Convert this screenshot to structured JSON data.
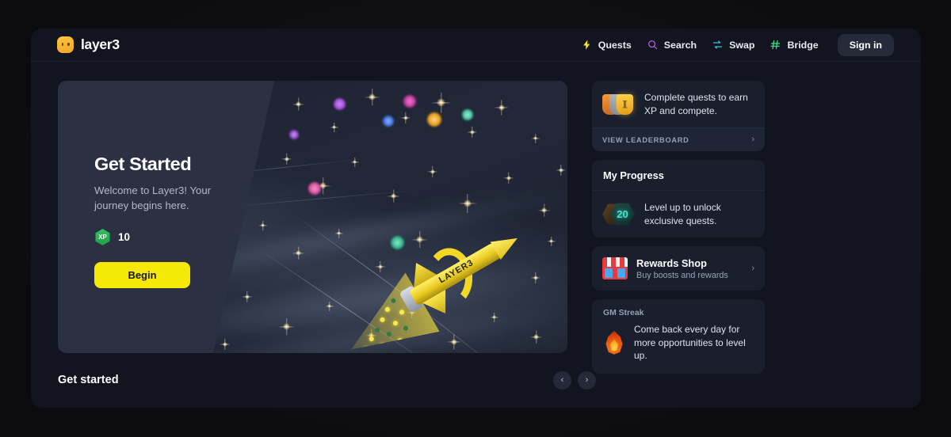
{
  "brand": {
    "name": "layer3",
    "logo_icon": "layer3-smiley-logo"
  },
  "nav": {
    "items": [
      {
        "label": "Quests",
        "icon": "lightning-bolt-icon",
        "color": "#f5e71a"
      },
      {
        "label": "Search",
        "icon": "search-icon",
        "color": "#c063e8"
      },
      {
        "label": "Swap",
        "icon": "swap-arrows-icon",
        "color": "#39c5d9"
      },
      {
        "label": "Bridge",
        "icon": "bridge-hash-icon",
        "color": "#3ddc84"
      }
    ],
    "sign_in_label": "Sign in"
  },
  "hero": {
    "title": "Get Started",
    "subtitle": "Welcome to Layer3! Your journey begins here.",
    "xp_badge_label": "XP",
    "xp_value": "10",
    "cta_label": "Begin",
    "artwork_rocket_label": "LAYER3"
  },
  "sidebar": {
    "leaderboard": {
      "text": "Complete quests to earn XP and compete.",
      "footer_label": "VIEW LEADERBOARD",
      "icon": "trophy-shields-icon",
      "chevron": "›"
    },
    "progress": {
      "heading": "My Progress",
      "level": "20",
      "text": "Level up to unlock exclusive quests.",
      "icon": "level-hex-badge-icon"
    },
    "rewards": {
      "title": "Rewards Shop",
      "subtitle": "Buy boosts and rewards",
      "icon": "shop-storefront-icon",
      "chevron": "›"
    },
    "streak": {
      "label": "GM Streak",
      "text": "Come back every day for more opportunities to level up.",
      "icon": "flame-icon"
    }
  },
  "bottom": {
    "title": "Get started",
    "prev_label": "‹",
    "next_label": "›"
  },
  "colors": {
    "accent_yellow": "#f6e906",
    "app_bg": "#12151f",
    "card_bg": "#1a1f2e",
    "page_bg": "#0c0c0e"
  }
}
